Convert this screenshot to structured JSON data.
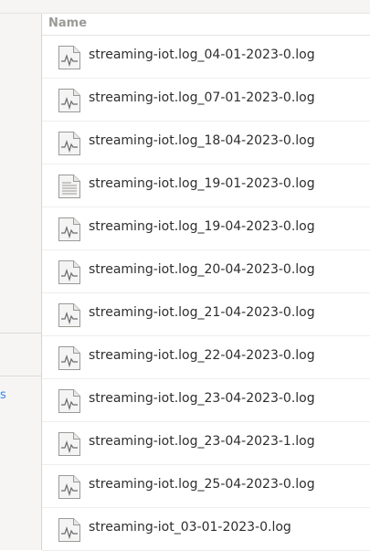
{
  "header": {
    "column_name": "Name"
  },
  "files": [
    {
      "name": "streaming-iot.log_04-01-2023-0.log",
      "icon": "log-file-icon"
    },
    {
      "name": "streaming-iot.log_07-01-2023-0.log",
      "icon": "log-file-icon"
    },
    {
      "name": "streaming-iot.log_18-04-2023-0.log",
      "icon": "log-file-icon"
    },
    {
      "name": "streaming-iot.log_19-01-2023-0.log",
      "icon": "text-file-icon"
    },
    {
      "name": "streaming-iot.log_19-04-2023-0.log",
      "icon": "log-file-icon"
    },
    {
      "name": "streaming-iot.log_20-04-2023-0.log",
      "icon": "log-file-icon"
    },
    {
      "name": "streaming-iot.log_21-04-2023-0.log",
      "icon": "log-file-icon"
    },
    {
      "name": "streaming-iot.log_22-04-2023-0.log",
      "icon": "log-file-icon"
    },
    {
      "name": "streaming-iot.log_23-04-2023-0.log",
      "icon": "log-file-icon"
    },
    {
      "name": "streaming-iot.log_23-04-2023-1.log",
      "icon": "log-file-icon"
    },
    {
      "name": "streaming-iot.log_25-04-2023-0.log",
      "icon": "log-file-icon"
    },
    {
      "name": "streaming-iot_03-01-2023-0.log",
      "icon": "log-file-icon"
    }
  ],
  "colors": {
    "accent": "#3584e4",
    "header_text": "#9a9996",
    "text": "#2e2e2e"
  }
}
